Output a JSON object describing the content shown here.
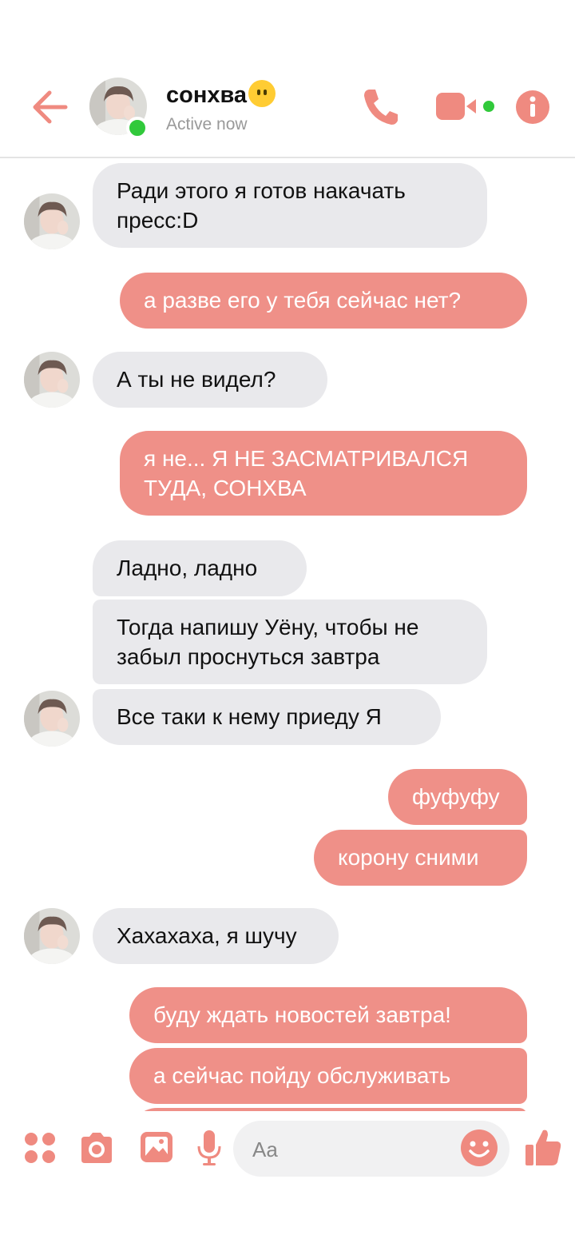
{
  "header": {
    "contact_name": "сонхва",
    "status": "Active now",
    "icons": [
      "back-arrow-icon",
      "phone-icon",
      "video-camera-icon",
      "info-icon"
    ],
    "accent_color": "#ef8a80",
    "online_color": "#31c93b"
  },
  "messages": [
    {
      "dir": "in",
      "text": "Ради этого я готов накачать\nпресс:D"
    },
    {
      "dir": "out",
      "text": "а разве его у тебя сейчас нет?"
    },
    {
      "dir": "in",
      "text": "А ты не видел?"
    },
    {
      "dir": "out",
      "text": "я не... Я НЕ ЗАСМАТРИВАЛСЯ\nТУДА, СОНХВА"
    },
    {
      "dir": "in",
      "text": "Ладно, ладно"
    },
    {
      "dir": "in",
      "text": "Тогда напишу Уёну, чтобы не\nзабыл проснуться завтра"
    },
    {
      "dir": "in",
      "text": "Все таки к нему приеду Я"
    },
    {
      "dir": "out",
      "text": "фуфуфу"
    },
    {
      "dir": "out",
      "text": "корону сними"
    },
    {
      "dir": "in",
      "text": "Хахахаха, я шучу"
    },
    {
      "dir": "out",
      "text": "буду ждать новостей завтра!"
    },
    {
      "dir": "out",
      "text": "а сейчас пойду обслуживать"
    }
  ],
  "composer": {
    "placeholder": "Aa",
    "icons": [
      "apps-icon",
      "camera-icon",
      "image-icon",
      "microphone-icon",
      "emoji-icon",
      "thumbs-up-icon"
    ]
  }
}
